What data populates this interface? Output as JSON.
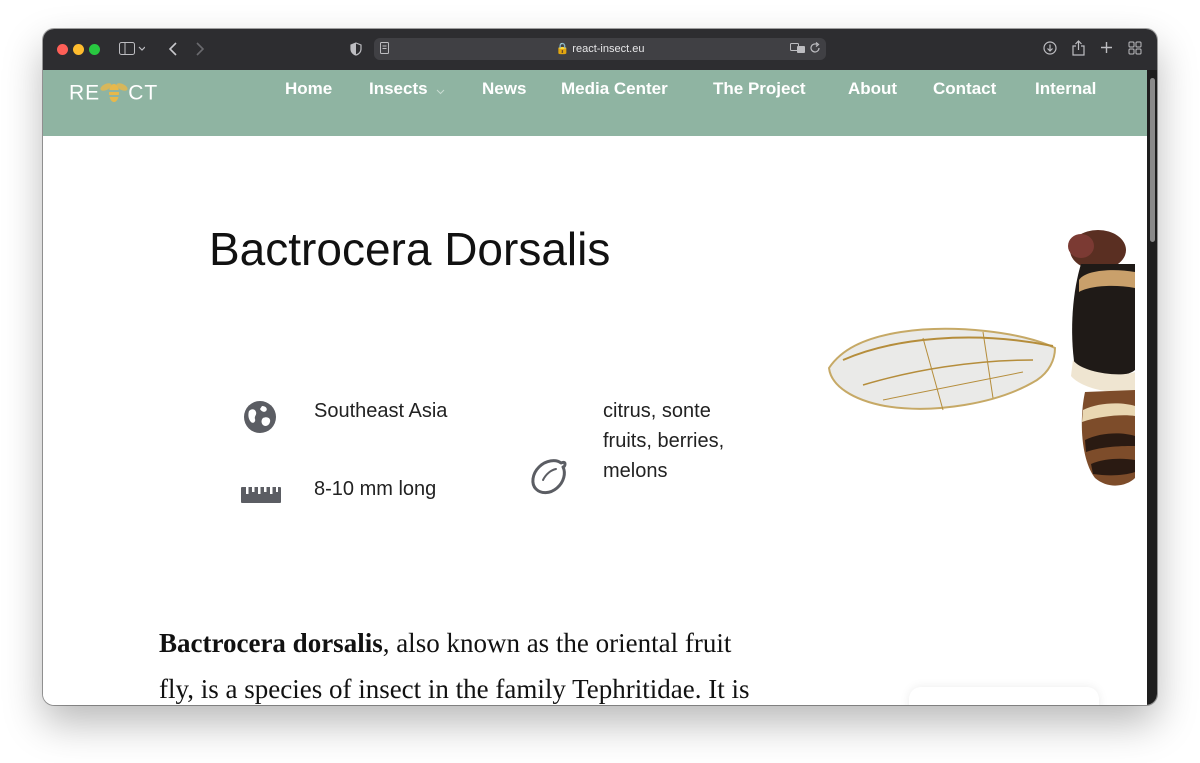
{
  "browser": {
    "url": "react-insect.eu"
  },
  "site": {
    "logo_text_left": "RE",
    "logo_text_right": "CT",
    "nav": [
      {
        "label": "Home"
      },
      {
        "label": "Insects"
      },
      {
        "label": "News"
      },
      {
        "label": "Media Center"
      },
      {
        "label": "The Project"
      },
      {
        "label": "About"
      },
      {
        "label": "Contact"
      },
      {
        "label": "Internal"
      }
    ],
    "colors": {
      "nav_bg": "#8fb4a2",
      "logo_accent": "#e8b84a",
      "icon_gray": "#5b5d63"
    }
  },
  "species": {
    "title": "Bactrocera Dorsalis",
    "distribution": "Southeast Asia",
    "size": "8-10 mm long",
    "host_line1": "citrus, sonte",
    "host_line2": "fruits, berries,",
    "host_line3": "melons",
    "icons": {
      "distribution": "globe-icon",
      "size": "ruler-icon",
      "host": "lemon-icon"
    },
    "description_bold": "Bactrocera dorsalis",
    "description_line1_rest": ", also known as the oriental fruit",
    "description_line2": "fly, is a species of insect in the family Tephritidae. It is"
  }
}
